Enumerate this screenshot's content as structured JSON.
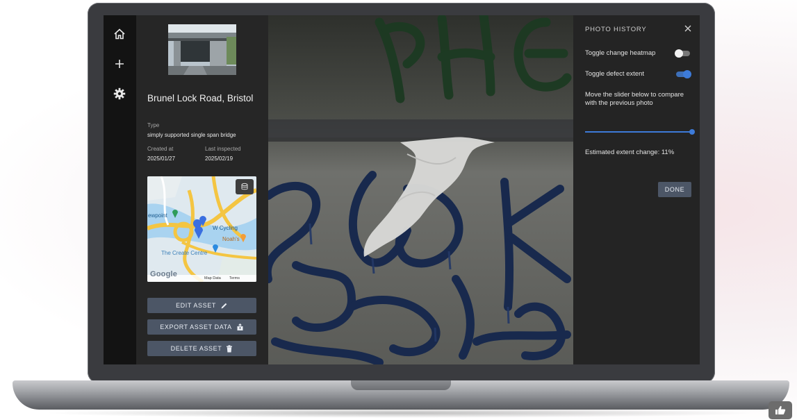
{
  "asset": {
    "title": "Brunel Lock Road, Bristol",
    "type_label": "Type",
    "type_value": "simply supported single span bridge",
    "created_label": "Created at",
    "created_value": "2025/01/27",
    "inspected_label": "Last inspected",
    "inspected_value": "2025/02/19"
  },
  "map": {
    "labels": [
      "ewpoint",
      "W Cycling",
      "Noah's",
      "The Create Centre"
    ],
    "google": "Google",
    "footer": [
      "Map Data",
      "Terms"
    ]
  },
  "actions": {
    "edit": "EDIT ASSET",
    "export": "EXPORT ASSET DATA",
    "delete": "DELETE ASSET"
  },
  "history": {
    "title": "PHOTO HISTORY",
    "heatmap_label": "Toggle change heatmap",
    "heatmap_on": false,
    "defect_label": "Toggle defect extent",
    "defect_on": true,
    "slider_hint": "Move the slider below to compare with the previous photo",
    "slider_value": 1.0,
    "estimate": "Estimated extent change: 11%",
    "done": "DONE"
  },
  "photo": {
    "graffiti_text": "PHE"
  },
  "colors": {
    "accent": "#3d7bd9",
    "button": "#4c5666"
  },
  "icons": [
    "home-icon",
    "plus-icon",
    "gear-icon",
    "pencil-icon",
    "export-icon",
    "trash-icon",
    "close-icon",
    "layers-icon",
    "thumbs-up-icon"
  ]
}
